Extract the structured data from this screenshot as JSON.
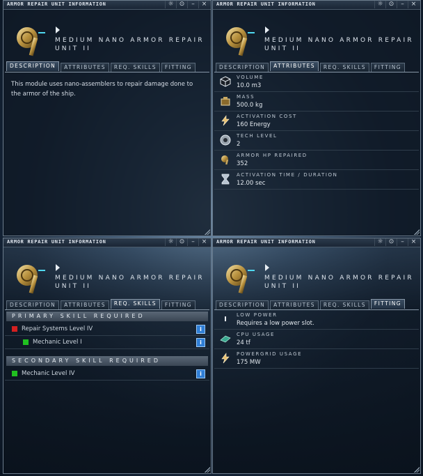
{
  "window_title": "ARMOR REPAIR UNIT INFORMATION",
  "title_buttons": [
    "☼",
    "⊙",
    "–",
    "×"
  ],
  "item_name": "MEDIUM NANO ARMOR REPAIR UNIT II",
  "tabs": [
    "DESCRIPTION",
    "ATTRIBUTES",
    "REQ. SKILLS",
    "FITTING"
  ],
  "description": "This module uses nano-assemblers to repair damage done to the armor of the ship.",
  "attributes": [
    {
      "icon": "cube-icon",
      "label": "VOLUME",
      "value": "10.0 m3"
    },
    {
      "icon": "mass-crate-icon",
      "label": "MASS",
      "value": "500.0 kg"
    },
    {
      "icon": "lightning-icon",
      "label": "ACTIVATION COST",
      "value": "160 Energy"
    },
    {
      "icon": "tech-gear-icon",
      "label": "TECH LEVEL",
      "value": "2"
    },
    {
      "icon": "armor-repair-icon",
      "label": "ARMOR HP REPAIRED",
      "value": "352"
    },
    {
      "icon": "hourglass-icon",
      "label": "ACTIVATION TIME / DURATION",
      "value": "12.00 sec"
    }
  ],
  "skills": {
    "primary_header": "PRIMARY SKILL REQUIRED",
    "primary": [
      {
        "name": "Repair Systems Level IV",
        "status_color": "#d42020",
        "indent": 0
      },
      {
        "name": "Mechanic Level I",
        "status_color": "#20c020",
        "indent": 1
      }
    ],
    "secondary_header": "SECONDARY SKILL REQUIRED",
    "secondary": [
      {
        "name": "Mechanic Level IV",
        "status_color": "#20c020",
        "indent": 0
      }
    ],
    "info_glyph": "i"
  },
  "fitting": [
    {
      "icon": "low-slot-icon",
      "label": "LOW POWER",
      "value": "Requires a low power slot."
    },
    {
      "icon": "cpu-icon",
      "label": "CPU USAGE",
      "value": "24 tf"
    },
    {
      "icon": "powergrid-icon",
      "label": "POWERGRID USAGE",
      "value": "175 MW"
    }
  ]
}
